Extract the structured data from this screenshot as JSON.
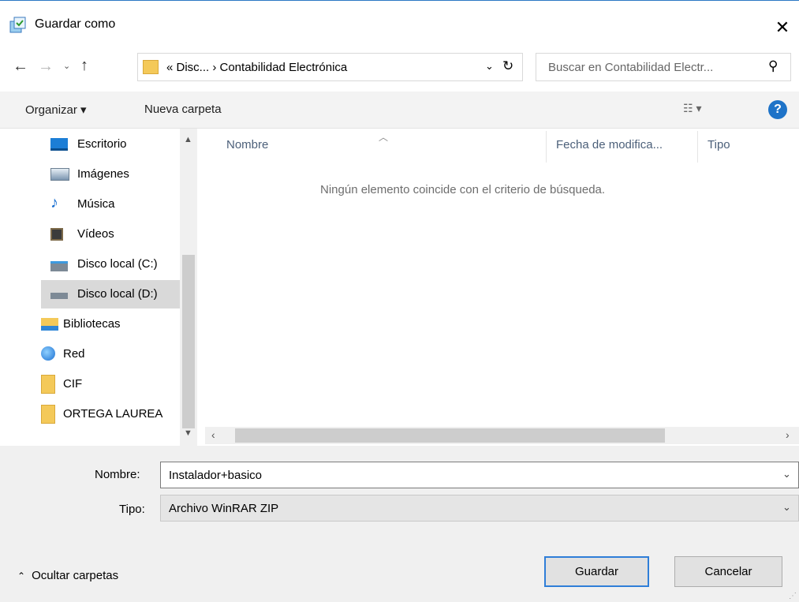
{
  "window": {
    "title": "Guardar como"
  },
  "address": {
    "path": "«  Disc...  ›  Contabilidad Electrónica"
  },
  "search": {
    "placeholder": "Buscar en Contabilidad Electr..."
  },
  "toolbar": {
    "organize_label": "Organizar ▾",
    "new_folder_label": "Nueva carpeta"
  },
  "sidebar": {
    "items": [
      {
        "label": "Escritorio",
        "icon": "desktop-icon"
      },
      {
        "label": "Imágenes",
        "icon": "pictures-icon"
      },
      {
        "label": "Música",
        "icon": "music-icon"
      },
      {
        "label": "Vídeos",
        "icon": "videos-icon"
      },
      {
        "label": "Disco local (C:)",
        "icon": "drive-c-icon"
      },
      {
        "label": "Disco local (D:)",
        "icon": "drive-d-icon",
        "selected": true
      },
      {
        "label": "Bibliotecas",
        "icon": "libraries-icon"
      },
      {
        "label": "Red",
        "icon": "network-icon"
      },
      {
        "label": "CIF",
        "icon": "folder-icon"
      },
      {
        "label": "ORTEGA LAUREA",
        "icon": "folder-icon"
      }
    ]
  },
  "filelist": {
    "columns": [
      "Nombre",
      "Fecha de modifica...",
      "Tipo"
    ],
    "empty_message": "Ningún elemento coincide con el criterio de búsqueda."
  },
  "form": {
    "name_label": "Nombre:",
    "name_value": "Instalador+basico",
    "type_label": "Tipo:",
    "type_value": "Archivo WinRAR ZIP"
  },
  "footer": {
    "hide_folders_label": "Ocultar carpetas",
    "save_label": "Guardar",
    "cancel_label": "Cancelar"
  },
  "colors": {
    "accent": "#1e73c8",
    "folder": "#f4c959",
    "selected_bg": "#d9d9d9"
  }
}
